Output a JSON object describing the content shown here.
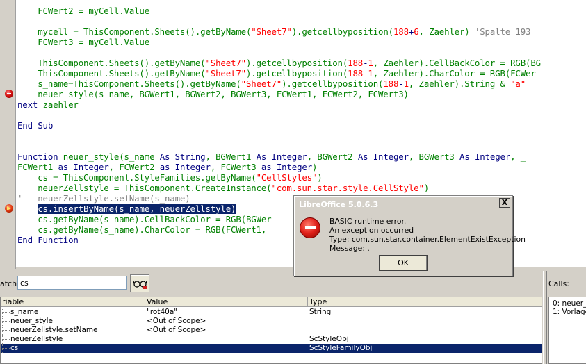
{
  "editor": {
    "code_lines": [
      {
        "segments": [
          {
            "t": "    FCWert2 = myCell.Value",
            "c": "tok-id"
          }
        ]
      },
      {
        "segments": []
      },
      {
        "segments": [
          {
            "t": "    mycell = ThisComponent.Sheets().getByName(",
            "c": "tok-id"
          },
          {
            "t": "\"Sheet7\"",
            "c": "tok-str"
          },
          {
            "t": ").getcellbyposition(",
            "c": "tok-id"
          },
          {
            "t": "188",
            "c": "tok-num"
          },
          {
            "t": "+",
            "c": "tok-op"
          },
          {
            "t": "6",
            "c": "tok-num"
          },
          {
            "t": ", Zaehler) ",
            "c": "tok-id"
          },
          {
            "t": "'Spalte 193",
            "c": "tok-com"
          }
        ]
      },
      {
        "segments": [
          {
            "t": "    FCWert3 = myCell.Value",
            "c": "tok-id"
          }
        ]
      },
      {
        "segments": []
      },
      {
        "segments": [
          {
            "t": "    ThisComponent.Sheets().getByName(",
            "c": "tok-id"
          },
          {
            "t": "\"Sheet7\"",
            "c": "tok-str"
          },
          {
            "t": ").getcellbyposition(",
            "c": "tok-id"
          },
          {
            "t": "188",
            "c": "tok-num"
          },
          {
            "t": "-",
            "c": "tok-op"
          },
          {
            "t": "1",
            "c": "tok-num"
          },
          {
            "t": ", Zaehler).CellBackColor = RGB(BG",
            "c": "tok-id"
          }
        ]
      },
      {
        "segments": [
          {
            "t": "    ThisComponent.Sheets().getByName(",
            "c": "tok-id"
          },
          {
            "t": "\"Sheet7\"",
            "c": "tok-str"
          },
          {
            "t": ").getcellbyposition(",
            "c": "tok-id"
          },
          {
            "t": "188",
            "c": "tok-num"
          },
          {
            "t": "-",
            "c": "tok-op"
          },
          {
            "t": "1",
            "c": "tok-num"
          },
          {
            "t": ", Zaehler).CharColor = RGB(FCWer",
            "c": "tok-id"
          }
        ]
      },
      {
        "segments": [
          {
            "t": "    s_name=ThisComponent.Sheets().getByName(",
            "c": "tok-id"
          },
          {
            "t": "\"Sheet7\"",
            "c": "tok-str"
          },
          {
            "t": ").getcellbyposition(",
            "c": "tok-id"
          },
          {
            "t": "188",
            "c": "tok-num"
          },
          {
            "t": "-",
            "c": "tok-op"
          },
          {
            "t": "1",
            "c": "tok-num"
          },
          {
            "t": ", Zaehler).String & ",
            "c": "tok-id"
          },
          {
            "t": "\"a\"",
            "c": "tok-str"
          }
        ]
      },
      {
        "segments": [
          {
            "t": "    neuer_style(s_name, BGWert1, BGWert2, BGWert3, FCWert1, FCWert2, FCWert3)",
            "c": "tok-id"
          }
        ]
      },
      {
        "segments": [
          {
            "t": "next ",
            "c": "tok-kw"
          },
          {
            "t": "zaehler",
            "c": "tok-id"
          }
        ]
      },
      {
        "segments": []
      },
      {
        "segments": [
          {
            "t": "End Sub",
            "c": "tok-kw"
          }
        ]
      },
      {
        "segments": []
      },
      {
        "segments": []
      },
      {
        "segments": [
          {
            "t": "Function ",
            "c": "tok-kw"
          },
          {
            "t": "neuer_style(s_name ",
            "c": "tok-id"
          },
          {
            "t": "As String",
            "c": "tok-kw"
          },
          {
            "t": ", BGWert1 ",
            "c": "tok-id"
          },
          {
            "t": "As Integer",
            "c": "tok-kw"
          },
          {
            "t": ", BGWert2 ",
            "c": "tok-id"
          },
          {
            "t": "As Integer",
            "c": "tok-kw"
          },
          {
            "t": ", BGWert3 ",
            "c": "tok-id"
          },
          {
            "t": "As Integer",
            "c": "tok-kw"
          },
          {
            "t": ", _",
            "c": "tok-id"
          }
        ]
      },
      {
        "segments": [
          {
            "t": "FCWert1 ",
            "c": "tok-id"
          },
          {
            "t": "as Integer",
            "c": "tok-kw"
          },
          {
            "t": ", FCWert2 ",
            "c": "tok-id"
          },
          {
            "t": "as Integer",
            "c": "tok-kw"
          },
          {
            "t": ", FCWert3 ",
            "c": "tok-id"
          },
          {
            "t": "as Integer",
            "c": "tok-kw"
          },
          {
            "t": ")",
            "c": "tok-id"
          }
        ]
      },
      {
        "segments": [
          {
            "t": "    cs = ThisComponent.StyleFamilies.getByName(",
            "c": "tok-id"
          },
          {
            "t": "\"CellStyles\"",
            "c": "tok-str"
          },
          {
            "t": ")",
            "c": "tok-id"
          }
        ]
      },
      {
        "segments": [
          {
            "t": "    neuerZellstyle = ThisComponent.CreateInstance(",
            "c": "tok-id"
          },
          {
            "t": "\"com.sun.star.style.CellStyle\"",
            "c": "tok-str"
          },
          {
            "t": ")",
            "c": "tok-id"
          }
        ]
      },
      {
        "segments": [
          {
            "t": "'   neuerZellstyle.setName(s_name)",
            "c": "tok-com"
          }
        ]
      },
      {
        "segments": [
          {
            "t": "    ",
            "c": "tok-id"
          },
          {
            "t": "cs.insertByName(s_name, neuerZellstyle)",
            "c": "hl"
          }
        ]
      },
      {
        "segments": [
          {
            "t": "    cs.getByName(s_name).CellBackColor = RGB(BGWer",
            "c": "tok-id"
          }
        ]
      },
      {
        "segments": [
          {
            "t": "    cs.getByName(s_name).CharColor = RGB(FCWert1, ",
            "c": "tok-id"
          }
        ]
      },
      {
        "segments": [
          {
            "t": "End Function",
            "c": "tok-kw"
          }
        ]
      }
    ],
    "markers": [
      {
        "line": 8,
        "kind": "breakpoint"
      },
      {
        "line": 19,
        "kind": "current"
      }
    ]
  },
  "watch": {
    "label": "atch:",
    "input_value": "cs",
    "columns": [
      "riable",
      "Value",
      "Type"
    ],
    "rows": [
      {
        "name": "s_name",
        "value": "\"rot40a\"",
        "type": "String",
        "selected": false
      },
      {
        "name": "neuer_style",
        "value": "<Out of Scope>",
        "type": "",
        "selected": false
      },
      {
        "name": "neuerZellstyle.setName",
        "value": "<Out of Scope>",
        "type": "",
        "selected": false
      },
      {
        "name": "neuerZellstyle",
        "value": "",
        "type": "ScStyleObj",
        "selected": false
      },
      {
        "name": "cs",
        "value": "",
        "type": "ScStyleFamilyObj",
        "selected": true
      }
    ]
  },
  "calls": {
    "label": "Calls:",
    "items": [
      "0: neuer_",
      "1: Vorlage"
    ]
  },
  "dialog": {
    "title": "LibreOffice 5.0.6.3",
    "close_glyph": "X",
    "lines": [
      "BASIC runtime error.",
      "An exception occurred",
      "Type: com.sun.star.container.ElementExistException",
      "Message: ."
    ],
    "ok_label": "OK"
  },
  "colors": {
    "keyword": "#000080",
    "identifier": "#008000",
    "string": "#ff0000",
    "comment": "#808080",
    "selection": "#0a246a"
  }
}
